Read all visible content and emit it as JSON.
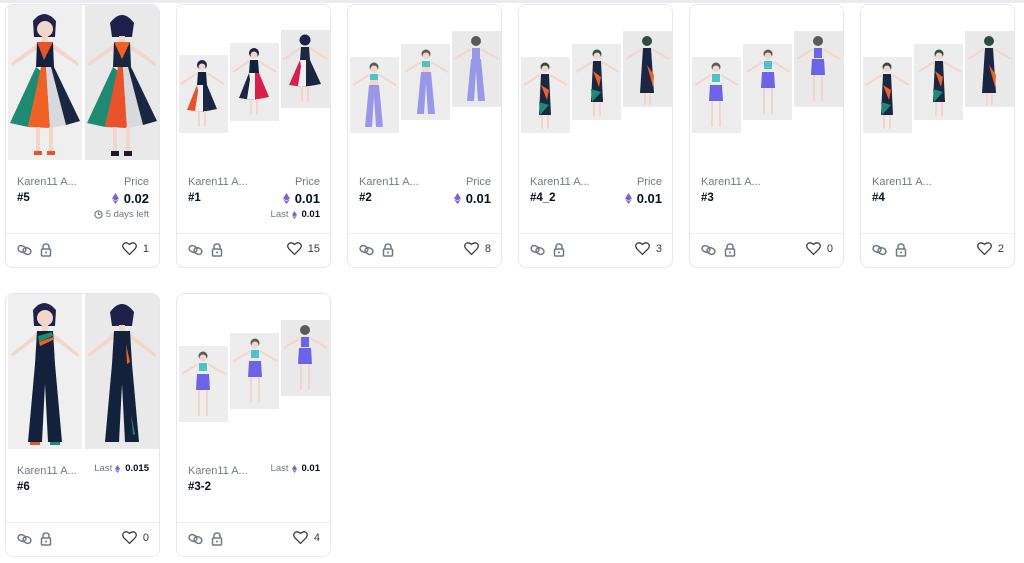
{
  "cards": [
    {
      "collection": "Karen11 A...",
      "token": "#5",
      "price_label": "Price",
      "price": "0.02",
      "time_left": "5 days left",
      "likes": "1",
      "style": "dress-2"
    },
    {
      "collection": "Karen11 A...",
      "token": "#1",
      "price_label": "Price",
      "price": "0.01",
      "last_label": "Last",
      "last": "0.01",
      "likes": "15",
      "style": "dress-3"
    },
    {
      "collection": "Karen11 A...",
      "token": "#2",
      "price_label": "Price",
      "price": "0.01",
      "likes": "8",
      "style": "lavender-3"
    },
    {
      "collection": "Karen11 A...",
      "token": "#4_2",
      "price_label": "Price",
      "price": "0.01",
      "likes": "3",
      "style": "gown-3"
    },
    {
      "collection": "Karen11 A...",
      "token": "#3",
      "likes": "0",
      "style": "shorts-3"
    },
    {
      "collection": "Karen11 A...",
      "token": "#4",
      "likes": "2",
      "style": "gown-3"
    },
    {
      "collection": "Karen11 A...",
      "token": "#6",
      "last_label": "Last",
      "last": "0.015",
      "likes": "0",
      "style": "jumpsuit-2"
    },
    {
      "collection": "Karen11 A...",
      "token": "#3-2",
      "last_label": "Last",
      "last": "0.01",
      "likes": "4",
      "style": "shorts-3"
    }
  ],
  "colors": {
    "eth": "#7b61d1",
    "border": "#e5e8eb",
    "muted": "#707a83",
    "text": "#04111d"
  },
  "icons": {
    "link": "link-icon",
    "lock": "lock-icon",
    "heart": "heart-icon",
    "eth": "ethereum-icon",
    "clock": "clock-icon"
  }
}
